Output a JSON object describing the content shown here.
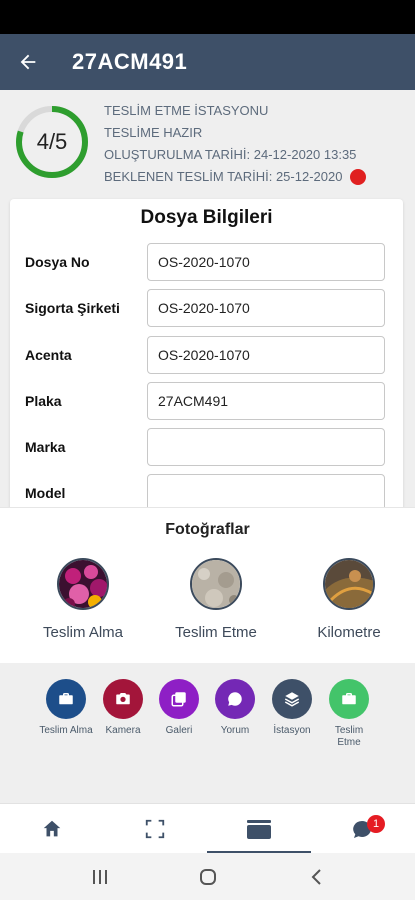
{
  "header": {
    "title": "27ACM491",
    "back_icon": "arrow-left-icon"
  },
  "status": {
    "progress_text": "4/5",
    "progress_fraction": 0.8,
    "progress_color": "#2e9e2e",
    "lines": [
      "TESLİM ETME İSTASYONU",
      "TESLİME HAZIR",
      "OLUŞTURULMA TARİHİ: 24-12-2020 13:35",
      "BEKLENEN TESLİM TARİHİ: 25-12-2020"
    ],
    "alert_color": "#e02020"
  },
  "form": {
    "title": "Dosya Bilgileri",
    "fields": [
      {
        "label": "Dosya No",
        "value": "OS-2020-1070"
      },
      {
        "label": "Sigorta Şirketi",
        "value": "OS-2020-1070"
      },
      {
        "label": "Acenta",
        "value": "OS-2020-1070"
      },
      {
        "label": "Plaka",
        "value": "27ACM491"
      },
      {
        "label": "Marka",
        "value": ""
      },
      {
        "label": "Model",
        "value": ""
      }
    ]
  },
  "photos": {
    "title": "Fotoğraflar",
    "items": [
      {
        "label": "Teslim Alma"
      },
      {
        "label": "Teslim Etme"
      },
      {
        "label": "Kilometre"
      }
    ]
  },
  "actions": [
    {
      "label": "Teslim Alma",
      "color": "#1d4e8a",
      "icon": "briefcase-icon"
    },
    {
      "label": "Kamera",
      "color": "#a3153a",
      "icon": "camera-icon"
    },
    {
      "label": "Galeri",
      "color": "#8e1fc5",
      "icon": "gallery-icon"
    },
    {
      "label": "Yorum",
      "color": "#7428b5",
      "icon": "comment-icon"
    },
    {
      "label": "İstasyon",
      "color": "#3e5068",
      "icon": "layers-icon"
    },
    {
      "label": "Teslim Etme",
      "color": "#43c46a",
      "icon": "briefcase-icon"
    }
  ],
  "bottom_nav": {
    "items": [
      "home-icon",
      "scan-icon",
      "folder-icon",
      "chat-icon"
    ],
    "active_index": 2,
    "badge_count": "1"
  },
  "system_nav": {
    "items": [
      "recent-apps-icon",
      "home-button-icon",
      "back-icon"
    ]
  }
}
